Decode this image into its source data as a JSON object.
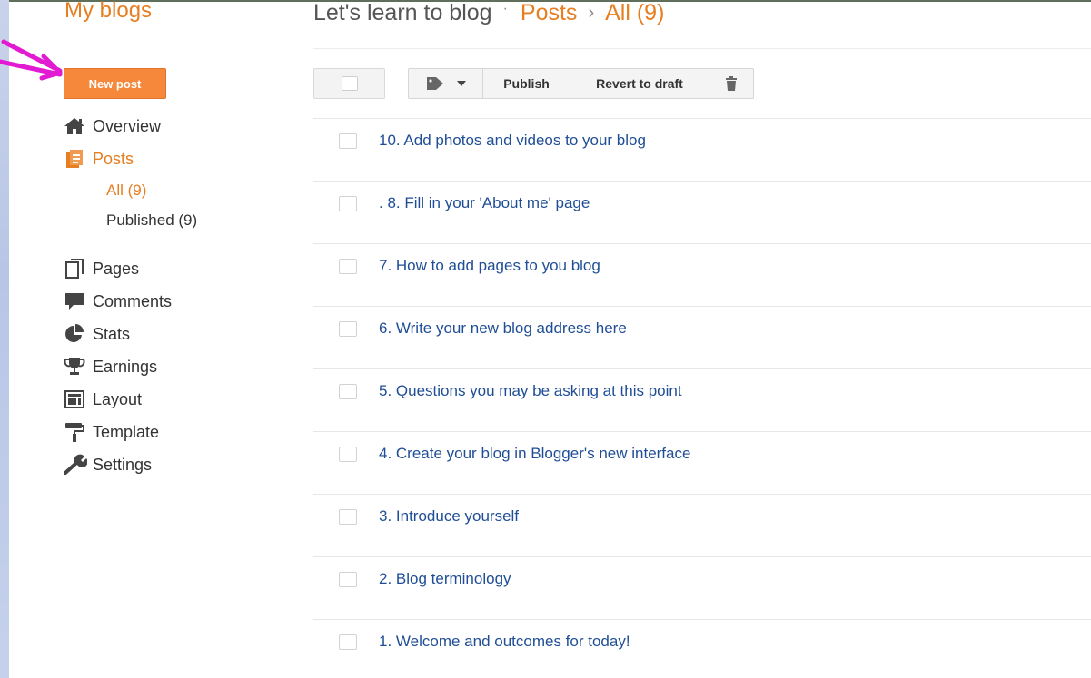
{
  "header": {
    "my_blogs": "My blogs",
    "blog_name": "Let's learn to blog",
    "dot": "·",
    "posts_link": "Posts",
    "separator": "›",
    "all_link": "All (9)"
  },
  "new_post_label": "New post",
  "sidebar": {
    "items": [
      {
        "label": "Overview",
        "icon": "home-icon"
      },
      {
        "label": "Posts",
        "icon": "posts-icon",
        "active": true
      },
      {
        "label": "Pages",
        "icon": "pages-icon"
      },
      {
        "label": "Comments",
        "icon": "comments-icon"
      },
      {
        "label": "Stats",
        "icon": "stats-icon"
      },
      {
        "label": "Earnings",
        "icon": "trophy-icon"
      },
      {
        "label": "Layout",
        "icon": "layout-icon"
      },
      {
        "label": "Template",
        "icon": "paint-roller-icon"
      },
      {
        "label": "Settings",
        "icon": "wrench-icon"
      }
    ],
    "subitems": [
      {
        "label": "All (9)",
        "active": true
      },
      {
        "label": "Published (9)"
      }
    ]
  },
  "toolbar": {
    "publish_label": "Publish",
    "revert_label": "Revert to draft",
    "label_icon": "tag-icon",
    "trash_icon": "trash-icon"
  },
  "posts": [
    {
      "title": "10. Add photos and videos to your blog"
    },
    {
      "title": ". 8. Fill in your 'About me' page"
    },
    {
      "title": "7. How to add pages to you blog"
    },
    {
      "title": "6. Write your new blog address here"
    },
    {
      "title": "5. Questions you may be asking at this point"
    },
    {
      "title": "4. Create your blog in Blogger's new interface"
    },
    {
      "title": "3. Introduce yourself"
    },
    {
      "title": "2. Blog terminology"
    },
    {
      "title": "1. Welcome and outcomes for today!"
    }
  ],
  "colors": {
    "accent": "#e67e22",
    "new_post_bg": "#f6883b",
    "link": "#1f4e96",
    "arrow": "#e21bd2"
  }
}
